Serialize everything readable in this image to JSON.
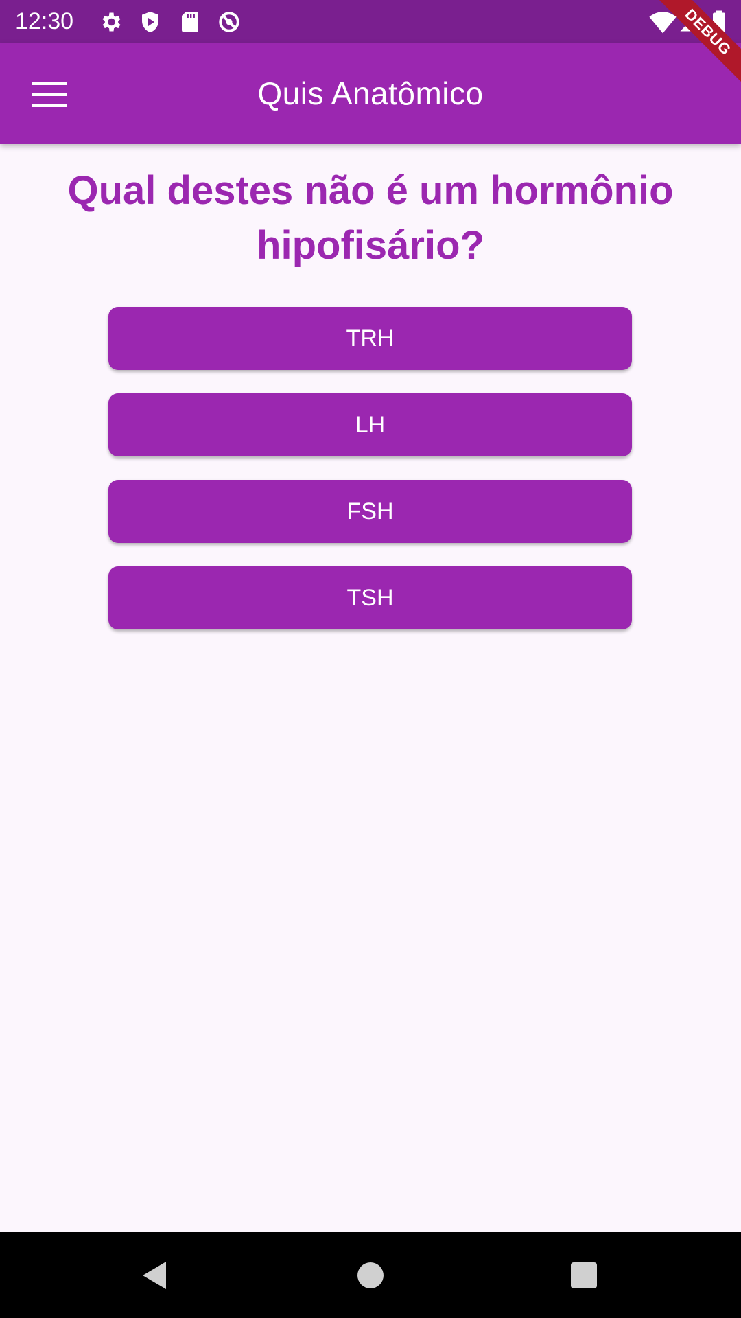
{
  "status_bar": {
    "time": "12:30",
    "icons": [
      "gear-icon",
      "shield-icon",
      "sd-card-icon",
      "sync-icon",
      "wifi-icon",
      "signal-icon",
      "battery-icon"
    ]
  },
  "app_bar": {
    "title": "Quis Anatômico",
    "menu_icon": "menu-icon"
  },
  "debug_banner": {
    "label": "DEBUG"
  },
  "quiz": {
    "question": "Qual destes não é um hormônio hipofisário?",
    "answers": [
      "TRH",
      "LH",
      "FSH",
      "TSH"
    ]
  },
  "nav_bar": {
    "icons": [
      "back-icon",
      "home-icon",
      "recents-icon"
    ]
  },
  "colors": {
    "primary": "#9b27b0",
    "status_bar": "#7a1f8f",
    "background": "#fcf6fd",
    "debug": "#b0182a"
  }
}
